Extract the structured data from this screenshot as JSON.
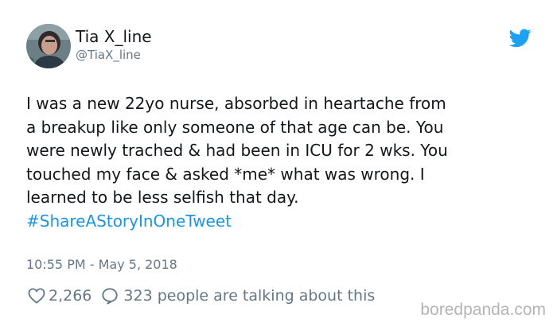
{
  "author": {
    "display_name": "Tia X_line",
    "handle": "@TiaX_line",
    "avatar_icon": "profile-photo"
  },
  "tweet": {
    "lines": [
      "I was a new 22yo nurse, absorbed in heartache from",
      "a breakup like only someone of that age can be. You",
      "were newly trached & had been in ICU for 2 wks. You",
      "touched my face & asked *me* what was wrong. I",
      "learned to be less selfish that day."
    ],
    "hashtag": "#ShareAStoryInOneTweet",
    "timestamp": "10:55 PM - May 5, 2018"
  },
  "actions": {
    "likes": "2,266",
    "talking": "323 people are talking about this"
  },
  "colors": {
    "text": "#14171a",
    "muted": "#657786",
    "twitter_blue": "#1da1f2",
    "hashtag": "#1b95e0"
  },
  "watermark": {
    "text": "boredpanda.com"
  }
}
